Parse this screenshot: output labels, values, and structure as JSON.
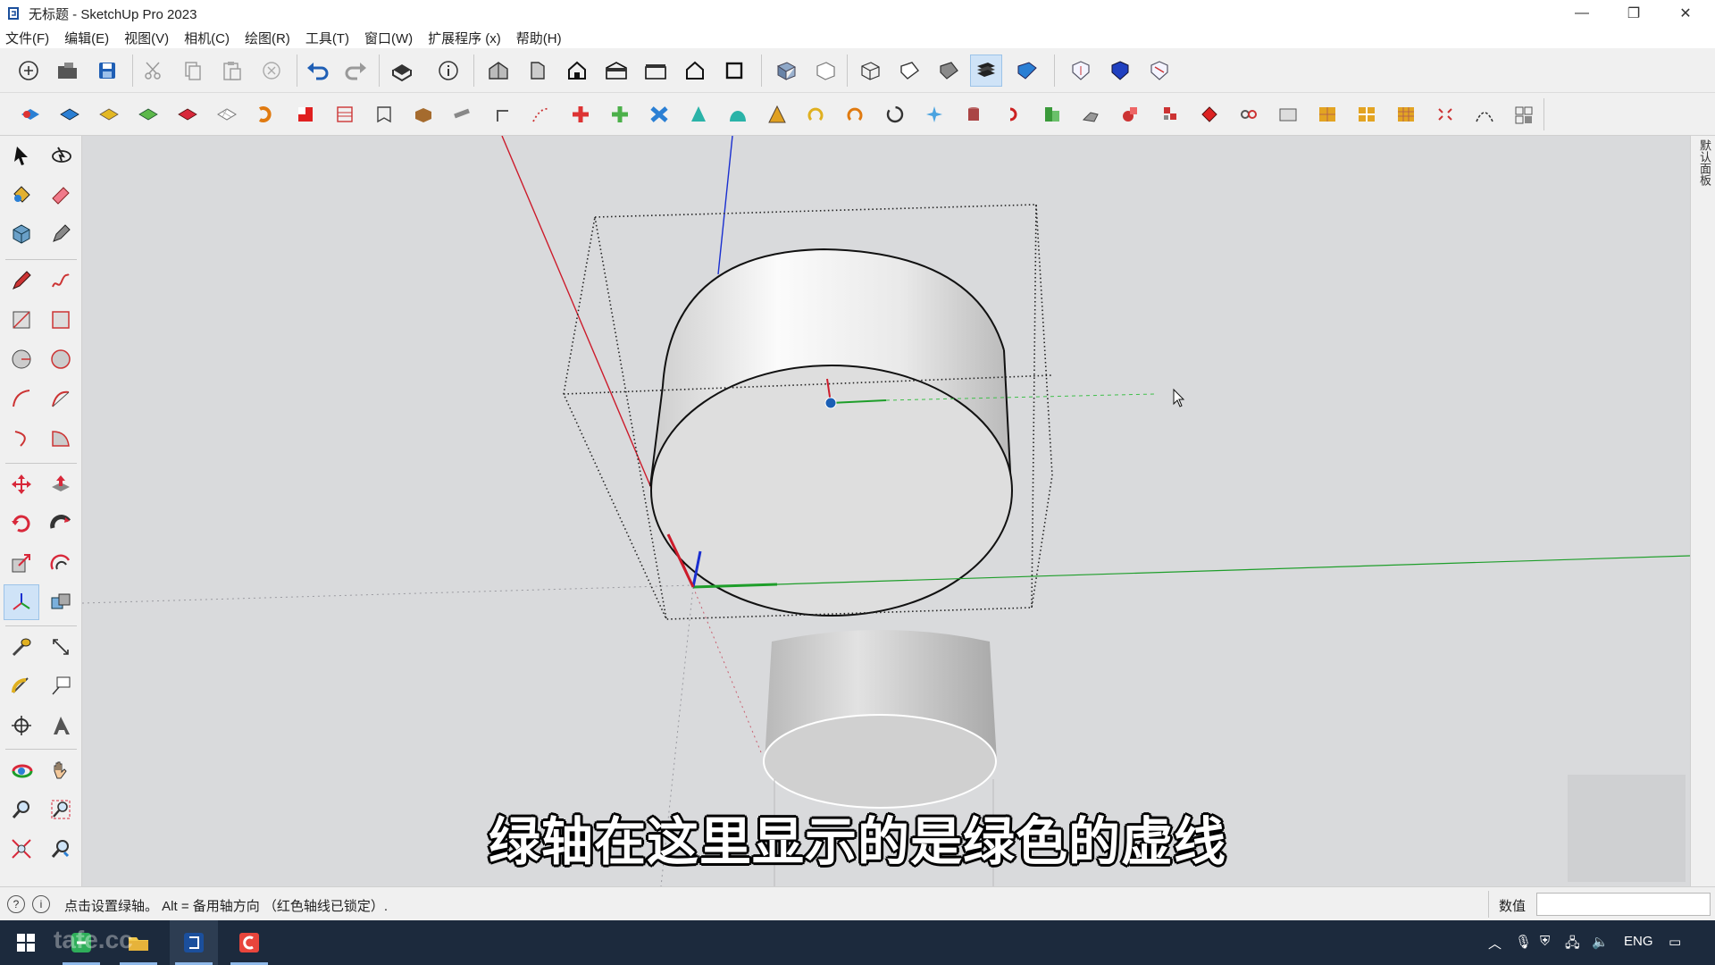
{
  "window": {
    "title": "无标题 - SketchUp Pro 2023",
    "minimize": "—",
    "restore": "❐",
    "close": "✕"
  },
  "menu": [
    "文件(F)",
    "编辑(E)",
    "视图(V)",
    "相机(C)",
    "绘图(R)",
    "工具(T)",
    "窗口(W)",
    "扩展程序 (x)",
    "帮助(H)"
  ],
  "right_tray": {
    "tab_label": "默认面板"
  },
  "subtitle": "绿轴在这里显示的是绿色的虚线",
  "status": {
    "message": "点击设置绿轴。 Alt = 备用轴方向 （红色轴线已锁定）.",
    "measurements_label": "数值",
    "measurements_value": ""
  },
  "taskbar": {
    "language": "ENG",
    "watermark": "tafe.cc"
  },
  "colors": {
    "viewport_bg": "#d9dadc",
    "red_axis": "#cc1b2b",
    "green_axis": "#1e9e2a",
    "blue_axis": "#1a2fd0",
    "toolbar_bg": "#f0f0f0",
    "taskbar_bg": "#1c2a3d"
  }
}
